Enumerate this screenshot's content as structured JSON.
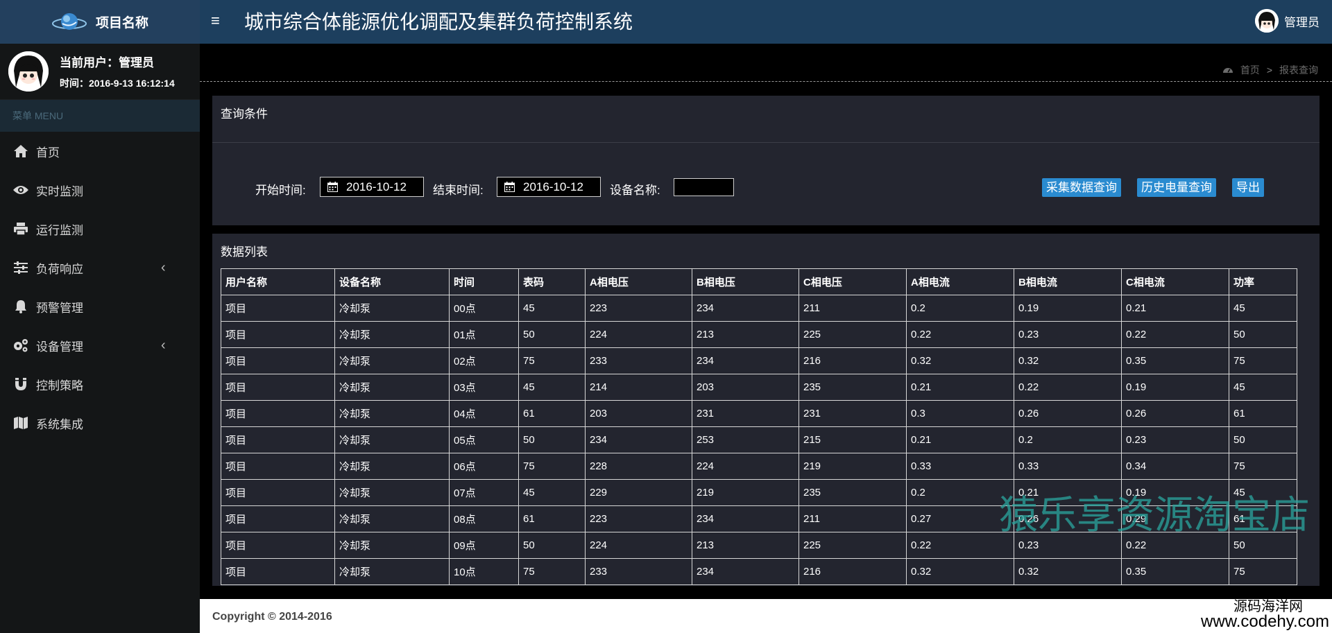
{
  "header": {
    "brand_title": "项目名称",
    "menu_toggle": "≡",
    "system_title": "城市综合体能源优化调配及集群负荷控制系统",
    "user_label": "管理员"
  },
  "sidebar": {
    "current_user": "当前用户：管理员",
    "time": "时间：2016-9-13 16:12:14",
    "menu_header": "菜单 MENU",
    "items": [
      {
        "label": "首页",
        "icon": "home-icon"
      },
      {
        "label": "实时监测",
        "icon": "eye-icon"
      },
      {
        "label": "运行监测",
        "icon": "print-icon"
      },
      {
        "label": "负荷响应",
        "icon": "sliders-icon",
        "chevron": "‹"
      },
      {
        "label": "预警管理",
        "icon": "bell-icon"
      },
      {
        "label": "设备管理",
        "icon": "gears-icon",
        "chevron": "‹"
      },
      {
        "label": "控制策略",
        "icon": "magnet-icon"
      },
      {
        "label": "系统集成",
        "icon": "map-icon"
      }
    ]
  },
  "breadcrumb": {
    "home": "首页",
    "separator": ">",
    "current": "报表查询"
  },
  "query": {
    "title": "查询条件",
    "start_label": "开始时间:",
    "start_value": "2016-10-12",
    "end_label": "结束时间:",
    "end_value": "2016-10-12",
    "device_label": "设备名称:",
    "device_value": "",
    "buttons": {
      "collect": "采集数据查询",
      "history": "历史电量查询",
      "export": "导出"
    }
  },
  "list": {
    "title": "数据列表",
    "columns": [
      "用户名称",
      "设备名称",
      "时间",
      "表码",
      "A相电压",
      "B相电压",
      "C相电压",
      "A相电流",
      "B相电流",
      "C相电流",
      "功率"
    ],
    "rows": [
      [
        "项目",
        "冷却泵",
        "00点",
        "45",
        "223",
        "234",
        "211",
        "0.2",
        "0.19",
        "0.21",
        "45"
      ],
      [
        "项目",
        "冷却泵",
        "01点",
        "50",
        "224",
        "213",
        "225",
        "0.22",
        "0.23",
        "0.22",
        "50"
      ],
      [
        "项目",
        "冷却泵",
        "02点",
        "75",
        "233",
        "234",
        "216",
        "0.32",
        "0.32",
        "0.35",
        "75"
      ],
      [
        "项目",
        "冷却泵",
        "03点",
        "45",
        "214",
        "203",
        "235",
        "0.21",
        "0.22",
        "0.19",
        "45"
      ],
      [
        "项目",
        "冷却泵",
        "04点",
        "61",
        "203",
        "231",
        "231",
        "0.3",
        "0.26",
        "0.26",
        "61"
      ],
      [
        "项目",
        "冷却泵",
        "05点",
        "50",
        "234",
        "253",
        "215",
        "0.21",
        "0.2",
        "0.23",
        "50"
      ],
      [
        "项目",
        "冷却泵",
        "06点",
        "75",
        "228",
        "224",
        "219",
        "0.33",
        "0.33",
        "0.34",
        "75"
      ],
      [
        "项目",
        "冷却泵",
        "07点",
        "45",
        "229",
        "219",
        "235",
        "0.2",
        "0.21",
        "0.19",
        "45"
      ],
      [
        "项目",
        "冷却泵",
        "08点",
        "61",
        "223",
        "234",
        "211",
        "0.27",
        "0.26",
        "0.29",
        "61"
      ],
      [
        "项目",
        "冷却泵",
        "09点",
        "50",
        "224",
        "213",
        "225",
        "0.22",
        "0.23",
        "0.22",
        "50"
      ],
      [
        "项目",
        "冷却泵",
        "10点",
        "75",
        "233",
        "234",
        "216",
        "0.32",
        "0.32",
        "0.35",
        "75"
      ]
    ]
  },
  "watermark": "猿乐享资源淘宝店",
  "footer": {
    "copyright": "Copyright © 2014-2016",
    "site_cn": "源码海洋网",
    "site_url": "www.codehy.com"
  },
  "colors": {
    "header_bg": "#1d3f5e",
    "sidebar_bg": "#141617",
    "panel_bg": "#23252f",
    "button_blue": "#2a8bd0",
    "watermark": "#2aa59e"
  }
}
